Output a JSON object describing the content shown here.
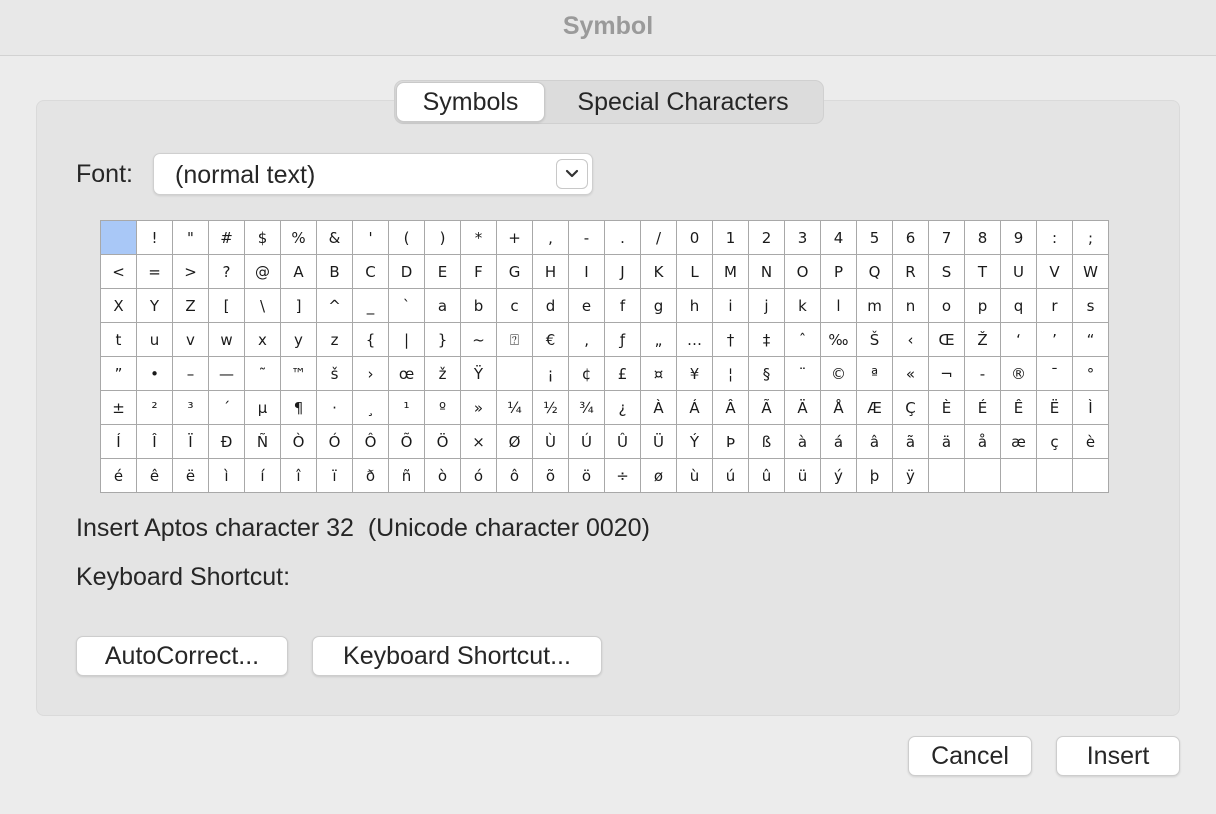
{
  "window": {
    "title": "Symbol"
  },
  "tabs": [
    {
      "label": "Symbols",
      "active": true
    },
    {
      "label": "Special Characters",
      "active": false
    }
  ],
  "font": {
    "label": "Font:",
    "value": "(normal text)"
  },
  "symbols": [
    " ",
    "!",
    "\"",
    "#",
    "$",
    "%",
    "&",
    "'",
    "(",
    ")",
    "*",
    "+",
    ",",
    "-",
    ".",
    "/",
    "0",
    "1",
    "2",
    "3",
    "4",
    "5",
    "6",
    "7",
    "8",
    "9",
    ":",
    ";",
    "<",
    "=",
    ">",
    "?",
    "@",
    "A",
    "B",
    "C",
    "D",
    "E",
    "F",
    "G",
    "H",
    "I",
    "J",
    "K",
    "L",
    "M",
    "N",
    "O",
    "P",
    "Q",
    "R",
    "S",
    "T",
    "U",
    "V",
    "W",
    "X",
    "Y",
    "Z",
    "[",
    "\\",
    "]",
    "^",
    "_",
    "`",
    "a",
    "b",
    "c",
    "d",
    "e",
    "f",
    "g",
    "h",
    "i",
    "j",
    "k",
    "l",
    "m",
    "n",
    "o",
    "p",
    "q",
    "r",
    "s",
    "t",
    "u",
    "v",
    "w",
    "x",
    "y",
    "z",
    "{",
    "|",
    "}",
    "~",
    "⍰",
    "€",
    "‚",
    "ƒ",
    "„",
    "…",
    "†",
    "‡",
    "ˆ",
    "‰",
    "Š",
    "‹",
    "Œ",
    "Ž",
    "‘",
    "’",
    "“",
    "”",
    "•",
    "–",
    "—",
    "˜",
    "™",
    "š",
    "›",
    "œ",
    "ž",
    "Ÿ",
    "",
    "¡",
    "¢",
    "£",
    "¤",
    "¥",
    "¦",
    "§",
    "¨",
    "©",
    "ª",
    "«",
    "¬",
    "-",
    "®",
    "¯",
    "°",
    "±",
    "²",
    "³",
    "´",
    "µ",
    "¶",
    "·",
    "¸",
    "¹",
    "º",
    "»",
    "¼",
    "½",
    "¾",
    "¿",
    "À",
    "Á",
    "Â",
    "Ã",
    "Ä",
    "Å",
    "Æ",
    "Ç",
    "È",
    "É",
    "Ê",
    "Ë",
    "Ì",
    "Í",
    "Î",
    "Ï",
    "Ð",
    "Ñ",
    "Ò",
    "Ó",
    "Ô",
    "Õ",
    "Ö",
    "×",
    "Ø",
    "Ù",
    "Ú",
    "Û",
    "Ü",
    "Ý",
    "Þ",
    "ß",
    "à",
    "á",
    "â",
    "ã",
    "ä",
    "å",
    "æ",
    "ç",
    "è",
    "é",
    "ê",
    "ë",
    "ì",
    "í",
    "î",
    "ï",
    "ð",
    "ñ",
    "ò",
    "ó",
    "ô",
    "õ",
    "ö",
    "÷",
    "ø",
    "ù",
    "ú",
    "û",
    "ü",
    "ý",
    "þ",
    "ÿ",
    "",
    "",
    "",
    "",
    ""
  ],
  "selected_index": 0,
  "info": {
    "insert_text": "Insert Aptos character 32  (Unicode character 0020)",
    "shortcut_label": "Keyboard Shortcut:"
  },
  "buttons": {
    "autocorrect": "AutoCorrect...",
    "keyboard_shortcut": "Keyboard Shortcut...",
    "cancel": "Cancel",
    "insert": "Insert"
  },
  "icons": {
    "font_dropdown": "chevron-down-icon"
  },
  "colors": {
    "selection": "#a9c8f7",
    "title": "#9a9a9a"
  }
}
